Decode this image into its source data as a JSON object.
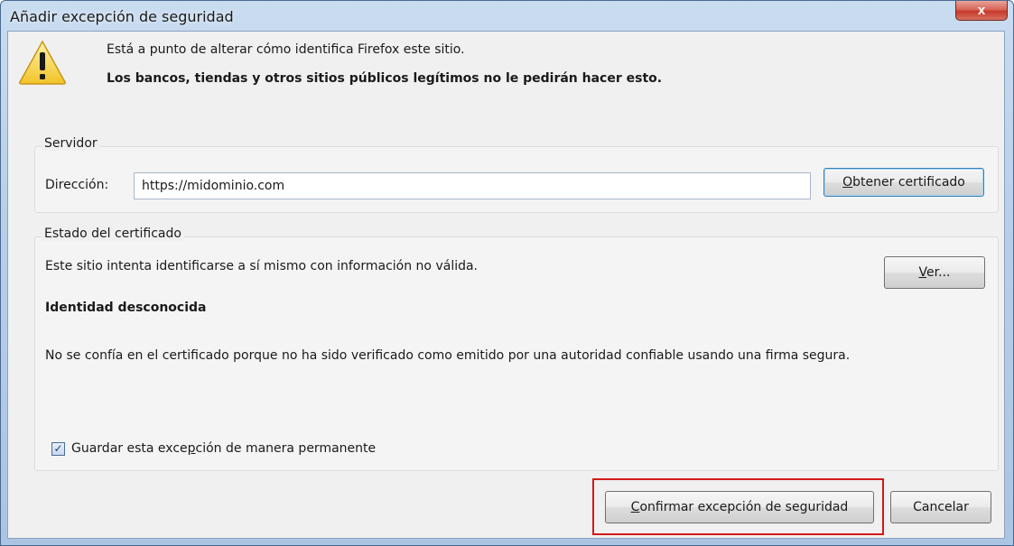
{
  "window": {
    "title": "Añadir excepción de seguridad",
    "close_label": "x"
  },
  "warning": {
    "line1": "Está a punto de alterar cómo identifica Firefox este sitio.",
    "line2": "Los bancos, tiendas y otros sitios públicos legítimos no le pedirán hacer esto."
  },
  "server": {
    "legend": "Servidor",
    "address_label": "Dirección:",
    "address_value": "https://midominio.com",
    "get_cert_button": {
      "accesskey": "O",
      "rest": "btener certificado"
    }
  },
  "cert_status": {
    "legend": "Estado del certificado",
    "description": "Este sitio intenta identificarse a sí mismo con información no válida.",
    "view_button": {
      "accesskey": "V",
      "rest": "er..."
    },
    "identity_heading": "Identidad desconocida",
    "detail": "No se confía en el certificado porque no ha sido verificado como emitido por una autoridad confiable usando una firma segura."
  },
  "save_permanent": {
    "checked": true,
    "label_before": "Guardar esta exce",
    "accesskey": "p",
    "label_after": "ción de manera permanente"
  },
  "actions": {
    "confirm": {
      "accesskey": "C",
      "rest": "onfirmar excepción de seguridad"
    },
    "cancel_label": "Cancelar"
  },
  "colors": {
    "highlight": "#d21919",
    "dialog_bg": "#f0f0f0",
    "titlebar": "#b8cfe8"
  },
  "icons": {
    "warning": "warning-triangle-icon",
    "close": "close-icon",
    "checkmark": "checkmark-icon"
  }
}
